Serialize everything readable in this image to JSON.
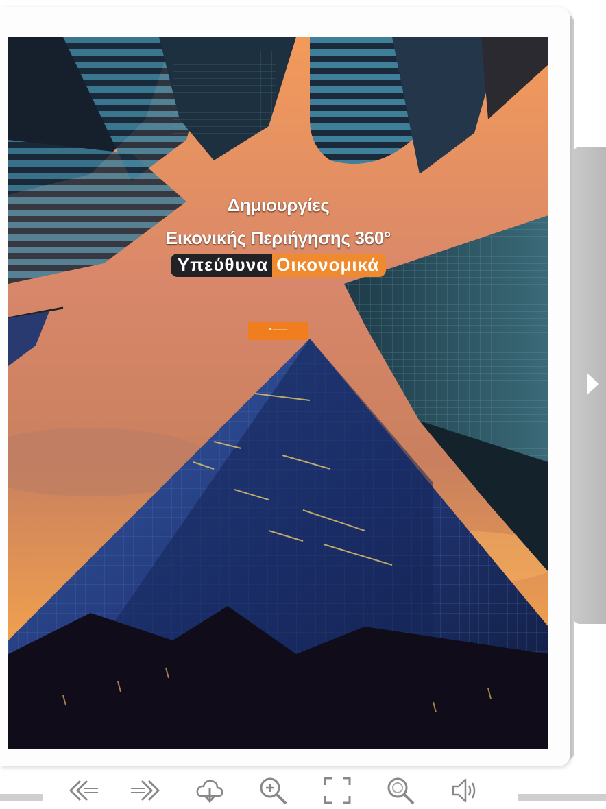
{
  "cover": {
    "title_line1": "Δημιουργίες",
    "title_line2": "Εικονικής Περιήγησης 360°",
    "title_dark": "Υπεύθυνα",
    "title_orange": "Οικονομικά",
    "cta_label": "■ ─────",
    "accent_color": "#f07e1e"
  },
  "navigation": {
    "next_icon": "chevron-right-icon"
  },
  "toolbar": {
    "buttons": [
      {
        "name": "previous-page-button",
        "icon": "double-arrow-left-icon"
      },
      {
        "name": "next-page-button",
        "icon": "double-arrow-right-icon"
      },
      {
        "name": "download-button",
        "icon": "cloud-download-icon"
      },
      {
        "name": "zoom-in-button",
        "icon": "zoom-in-icon"
      },
      {
        "name": "fullscreen-button",
        "icon": "fullscreen-icon"
      },
      {
        "name": "search-button",
        "icon": "search-icon"
      },
      {
        "name": "sound-button",
        "icon": "speaker-icon"
      }
    ]
  }
}
